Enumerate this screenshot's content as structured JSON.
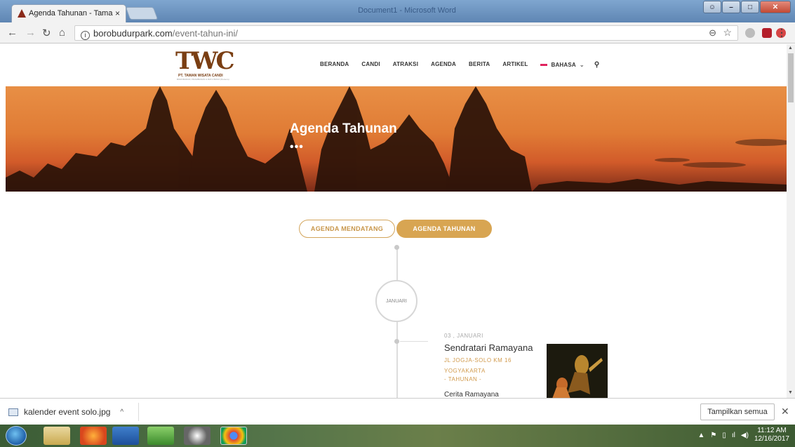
{
  "browser": {
    "tab_title": "Agenda Tahunan - Tama",
    "tab_close": "×",
    "window_title": "Document1 - Microsoft Word",
    "url_host": "borobudurpark.com",
    "url_path": "/event-tahun-ini/",
    "zoom_glyph": "⊖",
    "bookmark_glyph": "☆",
    "menu_glyph": "⋮"
  },
  "site": {
    "logo_text": "TWC",
    "logo_sub": "PT. TAMAN WISATA CANDI",
    "logo_sub2": "BOROBUDUR, PRAMBANAN & RATU BOKO (Persero)",
    "nav": [
      "BERANDA",
      "CANDI",
      "ATRAKSI",
      "AGENDA",
      "BERITA",
      "ARTIKEL"
    ],
    "language_label": "BAHASA",
    "hero_title": "Agenda Tahunan",
    "hero_dots": "•••",
    "toggle_left": "AGENDA MENDATANG",
    "toggle_right": "AGENDA TAHUNAN",
    "month": "JANUARI",
    "event": {
      "date": "03 , JANUARI",
      "title": "Sendratari Ramayana",
      "location_line1": "JL JOGJA-SOLO KM 16",
      "location_line2": "YOGYAKARTA",
      "kind": "- TAHUNAN -",
      "description": "Cerita Ramayana"
    }
  },
  "downloads": {
    "file_name": "kalender event solo.jpg",
    "show_all": "Tampilkan semua"
  },
  "taskbar": {
    "time": "11:12 AM",
    "date": "12/16/2017"
  },
  "colors": {
    "accent_gold": "#d8a552",
    "brand_brown": "#7a3e13",
    "hero_orange": "#e07b35"
  }
}
